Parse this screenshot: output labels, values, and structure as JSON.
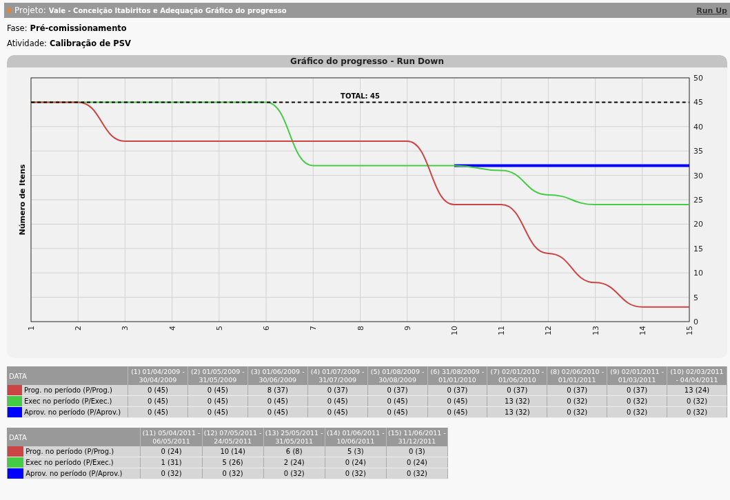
{
  "header": {
    "label": "Projeto:",
    "project": "Vale - Conceição Itabiritos e Adequação Gráfico do progresso",
    "link": "Run Up"
  },
  "fields": [
    {
      "label": "Fase:",
      "value": "Pré-comissionamento"
    },
    {
      "label": "Atividade:",
      "value": "Calibração de PSV"
    }
  ],
  "chart": {
    "title": "Gráfico do progresso - Run Down",
    "chart_data": {
      "type": "line",
      "ylabel": "Número de Itens",
      "x": [
        1,
        2,
        3,
        4,
        5,
        6,
        7,
        8,
        9,
        10,
        11,
        12,
        13,
        14,
        15
      ],
      "xlim": [
        1,
        15
      ],
      "ylim": [
        0,
        50
      ],
      "xticks": [
        1,
        2,
        3,
        4,
        5,
        6,
        7,
        8,
        9,
        10,
        11,
        12,
        13,
        14,
        15
      ],
      "yticks": [
        0,
        5,
        10,
        15,
        20,
        25,
        30,
        35,
        40,
        45,
        50
      ],
      "grid": true,
      "series": [
        {
          "color": "#0000ff",
          "values": [
            null,
            null,
            null,
            null,
            null,
            null,
            null,
            null,
            null,
            32,
            32,
            32,
            32,
            32,
            32
          ]
        },
        {
          "color": "#44cc44",
          "values": [
            45,
            45,
            45,
            45,
            45,
            45,
            32,
            32,
            32,
            32,
            31,
            26,
            24,
            24,
            24
          ]
        },
        {
          "color": "#cc4444",
          "values": [
            45,
            45,
            37,
            37,
            37,
            37,
            37,
            37,
            37,
            24,
            24,
            14,
            8,
            3,
            3
          ]
        },
        {
          "name": "TOTAL: 45",
          "color": "#000000",
          "line_style": "dashed",
          "values": [
            45,
            45,
            45,
            45,
            45,
            45,
            45,
            45,
            45,
            45,
            45,
            45,
            45,
            45,
            45
          ]
        }
      ]
    }
  },
  "tables": [
    {
      "header_label": "DATA",
      "columns": [
        "(1) 01/04/2009 - 30/04/2009",
        "(2) 01/05/2009 - 31/05/2009",
        "(3) 01/06/2009 - 30/06/2009",
        "(4) 01/07/2009 - 31/07/2009",
        "(5) 01/08/2009 - 30/08/2009",
        "(6) 31/08/2009 - 01/01/2010",
        "(7) 02/01/2010 - 01/06/2010",
        "(8) 02/06/2010 - 01/01/2011",
        "(9) 02/01/2011 - 01/03/2011",
        "(10) 02/03/2011 - 04/04/2011"
      ],
      "rows": [
        {
          "label": "Prog. no período (P/Prog.)",
          "color": "#cc4444",
          "values": [
            "0 (45)",
            "0 (45)",
            "8 (37)",
            "0 (37)",
            "0 (37)",
            "0 (37)",
            "0 (37)",
            "0 (37)",
            "0 (37)",
            "13 (24)"
          ]
        },
        {
          "label": "Exec no período (P/Exec.)",
          "color": "#44cc44",
          "values": [
            "0 (45)",
            "0 (45)",
            "0 (45)",
            "0 (45)",
            "0 (45)",
            "0 (45)",
            "13 (32)",
            "0 (32)",
            "0 (32)",
            "0 (32)"
          ]
        },
        {
          "label": "Aprov. no período (P/Aprov.)",
          "color": "#0000ff",
          "values": [
            "0 (45)",
            "0 (45)",
            "0 (45)",
            "0 (45)",
            "0 (45)",
            "0 (45)",
            "13 (32)",
            "0 (32)",
            "0 (32)",
            "0 (32)"
          ]
        }
      ]
    },
    {
      "header_label": "DATA",
      "columns": [
        "(11) 05/04/2011 - 06/05/2011",
        "(12) 07/05/2011 - 24/05/2011",
        "(13) 25/05/2011 - 31/05/2011",
        "(14) 01/06/2011 - 10/06/2011",
        "(15) 11/06/2011 - 31/12/2011"
      ],
      "rows": [
        {
          "label": "Prog. no período (P/Prog.)",
          "color": "#cc4444",
          "values": [
            "0 (24)",
            "10 (14)",
            "6 (8)",
            "5 (3)",
            "0 (3)"
          ]
        },
        {
          "label": "Exec no período (P/Exec.)",
          "color": "#44cc44",
          "values": [
            "1 (31)",
            "5 (26)",
            "2 (24)",
            "0 (24)",
            "0 (24)"
          ]
        },
        {
          "label": "Aprov. no período (P/Aprov.)",
          "color": "#0000ff",
          "values": [
            "0 (32)",
            "0 (32)",
            "0 (32)",
            "0 (32)",
            "0 (32)"
          ]
        }
      ]
    }
  ]
}
